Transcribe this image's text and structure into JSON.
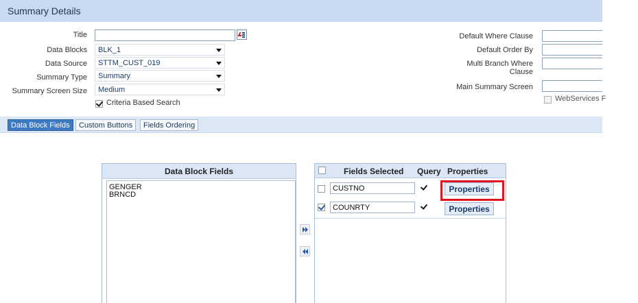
{
  "header": {
    "title": "Summary Details"
  },
  "form_left": {
    "title_label": "Title",
    "title_value": "",
    "data_blocks_label": "Data Blocks",
    "data_blocks_value": "BLK_1",
    "data_source_label": "Data Source",
    "data_source_value": "STTM_CUST_019",
    "summary_type_label": "Summary Type",
    "summary_type_value": "Summary",
    "screen_size_label": "Summary Screen Size",
    "screen_size_value": "Medium",
    "criteria_label": "Criteria Based Search",
    "criteria_checked": true
  },
  "form_right": {
    "default_where_label": "Default Where Clause",
    "default_order_label": "Default Order By",
    "multi_branch_label": "Multi Branch Where Clause",
    "main_summary_label": "Main Summary Screen",
    "webservices_label": "WebServices F"
  },
  "tabs": [
    {
      "label": "Data Block Fields",
      "active": true
    },
    {
      "label": "Custom Buttons",
      "active": false
    },
    {
      "label": "Fields Ordering",
      "active": false
    }
  ],
  "data_block_fields": {
    "header": "Data Block Fields",
    "items": [
      "GENGER",
      "BRNCD"
    ]
  },
  "selected_grid": {
    "headers": {
      "fields_selected": "Fields Selected",
      "query": "Query",
      "properties": "Properties"
    },
    "rows": [
      {
        "field": "CUSTNO",
        "selected": false,
        "query": true,
        "button": "Properties"
      },
      {
        "field": "COUNRTY",
        "selected": true,
        "query": true,
        "button": "Properties"
      }
    ]
  },
  "colors": {
    "header_bg": "#c9daf0",
    "tab_active": "#3f79bf",
    "highlight": "#e0141f"
  }
}
